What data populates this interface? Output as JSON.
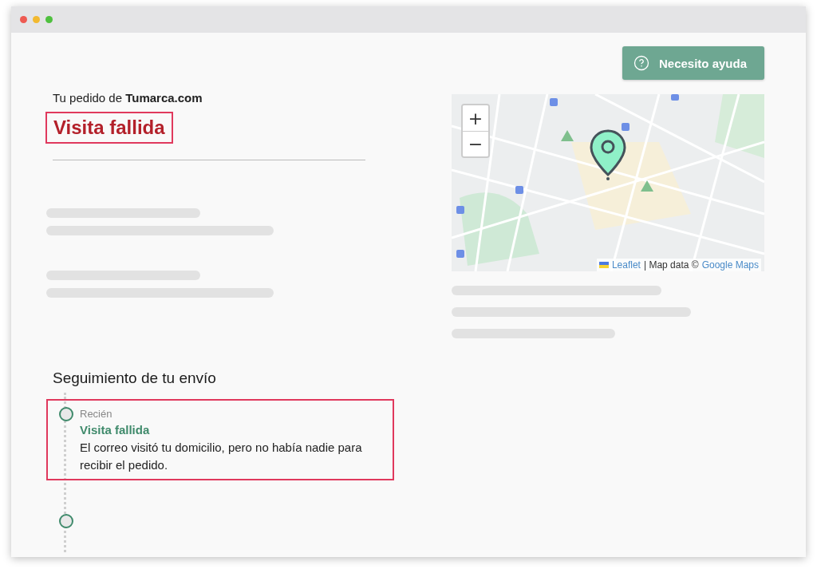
{
  "help_button": {
    "label": "Necesito ayuda"
  },
  "order": {
    "intro": "Tu pedido de **Tumarca.com**",
    "status": "Visita fallida",
    "highlighted": true
  },
  "map": {
    "zoom_in": "+",
    "zoom_out": "−",
    "attribution": {
      "library_link": "Leaflet",
      "separator": "| Map data ©",
      "provider_link": "Google Maps"
    }
  },
  "tracking": {
    "heading": "Seguimiento de tu envío",
    "events": [
      {
        "time": "Recién",
        "title": "Visita fallida",
        "description": "El correo visitó tu domicilio, pero no había nadie para recibir el pedido.",
        "highlighted": true
      },
      {
        "highlighted": false
      }
    ]
  }
}
